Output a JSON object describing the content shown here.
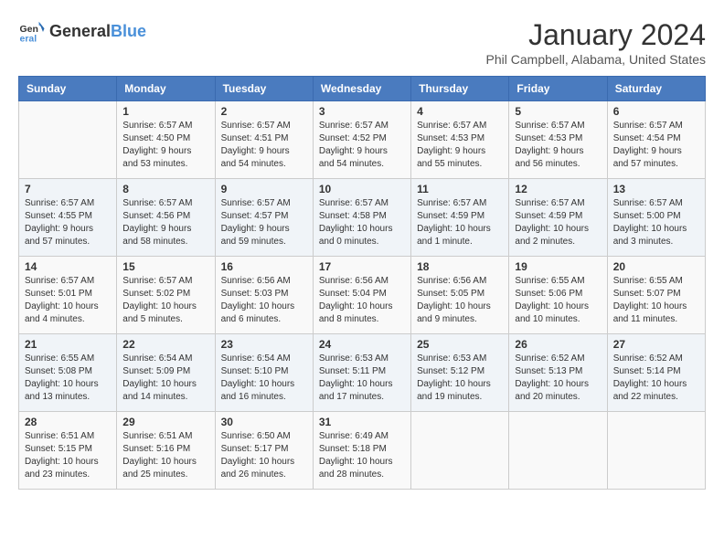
{
  "logo": {
    "text_general": "General",
    "text_blue": "Blue"
  },
  "header": {
    "month_title": "January 2024",
    "location": "Phil Campbell, Alabama, United States"
  },
  "weekdays": [
    "Sunday",
    "Monday",
    "Tuesday",
    "Wednesday",
    "Thursday",
    "Friday",
    "Saturday"
  ],
  "weeks": [
    [
      {
        "day": "",
        "info": ""
      },
      {
        "day": "1",
        "info": "Sunrise: 6:57 AM\nSunset: 4:50 PM\nDaylight: 9 hours\nand 53 minutes."
      },
      {
        "day": "2",
        "info": "Sunrise: 6:57 AM\nSunset: 4:51 PM\nDaylight: 9 hours\nand 54 minutes."
      },
      {
        "day": "3",
        "info": "Sunrise: 6:57 AM\nSunset: 4:52 PM\nDaylight: 9 hours\nand 54 minutes."
      },
      {
        "day": "4",
        "info": "Sunrise: 6:57 AM\nSunset: 4:53 PM\nDaylight: 9 hours\nand 55 minutes."
      },
      {
        "day": "5",
        "info": "Sunrise: 6:57 AM\nSunset: 4:53 PM\nDaylight: 9 hours\nand 56 minutes."
      },
      {
        "day": "6",
        "info": "Sunrise: 6:57 AM\nSunset: 4:54 PM\nDaylight: 9 hours\nand 57 minutes."
      }
    ],
    [
      {
        "day": "7",
        "info": "Sunrise: 6:57 AM\nSunset: 4:55 PM\nDaylight: 9 hours\nand 57 minutes."
      },
      {
        "day": "8",
        "info": "Sunrise: 6:57 AM\nSunset: 4:56 PM\nDaylight: 9 hours\nand 58 minutes."
      },
      {
        "day": "9",
        "info": "Sunrise: 6:57 AM\nSunset: 4:57 PM\nDaylight: 9 hours\nand 59 minutes."
      },
      {
        "day": "10",
        "info": "Sunrise: 6:57 AM\nSunset: 4:58 PM\nDaylight: 10 hours\nand 0 minutes."
      },
      {
        "day": "11",
        "info": "Sunrise: 6:57 AM\nSunset: 4:59 PM\nDaylight: 10 hours\nand 1 minute."
      },
      {
        "day": "12",
        "info": "Sunrise: 6:57 AM\nSunset: 4:59 PM\nDaylight: 10 hours\nand 2 minutes."
      },
      {
        "day": "13",
        "info": "Sunrise: 6:57 AM\nSunset: 5:00 PM\nDaylight: 10 hours\nand 3 minutes."
      }
    ],
    [
      {
        "day": "14",
        "info": "Sunrise: 6:57 AM\nSunset: 5:01 PM\nDaylight: 10 hours\nand 4 minutes."
      },
      {
        "day": "15",
        "info": "Sunrise: 6:57 AM\nSunset: 5:02 PM\nDaylight: 10 hours\nand 5 minutes."
      },
      {
        "day": "16",
        "info": "Sunrise: 6:56 AM\nSunset: 5:03 PM\nDaylight: 10 hours\nand 6 minutes."
      },
      {
        "day": "17",
        "info": "Sunrise: 6:56 AM\nSunset: 5:04 PM\nDaylight: 10 hours\nand 8 minutes."
      },
      {
        "day": "18",
        "info": "Sunrise: 6:56 AM\nSunset: 5:05 PM\nDaylight: 10 hours\nand 9 minutes."
      },
      {
        "day": "19",
        "info": "Sunrise: 6:55 AM\nSunset: 5:06 PM\nDaylight: 10 hours\nand 10 minutes."
      },
      {
        "day": "20",
        "info": "Sunrise: 6:55 AM\nSunset: 5:07 PM\nDaylight: 10 hours\nand 11 minutes."
      }
    ],
    [
      {
        "day": "21",
        "info": "Sunrise: 6:55 AM\nSunset: 5:08 PM\nDaylight: 10 hours\nand 13 minutes."
      },
      {
        "day": "22",
        "info": "Sunrise: 6:54 AM\nSunset: 5:09 PM\nDaylight: 10 hours\nand 14 minutes."
      },
      {
        "day": "23",
        "info": "Sunrise: 6:54 AM\nSunset: 5:10 PM\nDaylight: 10 hours\nand 16 minutes."
      },
      {
        "day": "24",
        "info": "Sunrise: 6:53 AM\nSunset: 5:11 PM\nDaylight: 10 hours\nand 17 minutes."
      },
      {
        "day": "25",
        "info": "Sunrise: 6:53 AM\nSunset: 5:12 PM\nDaylight: 10 hours\nand 19 minutes."
      },
      {
        "day": "26",
        "info": "Sunrise: 6:52 AM\nSunset: 5:13 PM\nDaylight: 10 hours\nand 20 minutes."
      },
      {
        "day": "27",
        "info": "Sunrise: 6:52 AM\nSunset: 5:14 PM\nDaylight: 10 hours\nand 22 minutes."
      }
    ],
    [
      {
        "day": "28",
        "info": "Sunrise: 6:51 AM\nSunset: 5:15 PM\nDaylight: 10 hours\nand 23 minutes."
      },
      {
        "day": "29",
        "info": "Sunrise: 6:51 AM\nSunset: 5:16 PM\nDaylight: 10 hours\nand 25 minutes."
      },
      {
        "day": "30",
        "info": "Sunrise: 6:50 AM\nSunset: 5:17 PM\nDaylight: 10 hours\nand 26 minutes."
      },
      {
        "day": "31",
        "info": "Sunrise: 6:49 AM\nSunset: 5:18 PM\nDaylight: 10 hours\nand 28 minutes."
      },
      {
        "day": "",
        "info": ""
      },
      {
        "day": "",
        "info": ""
      },
      {
        "day": "",
        "info": ""
      }
    ]
  ]
}
